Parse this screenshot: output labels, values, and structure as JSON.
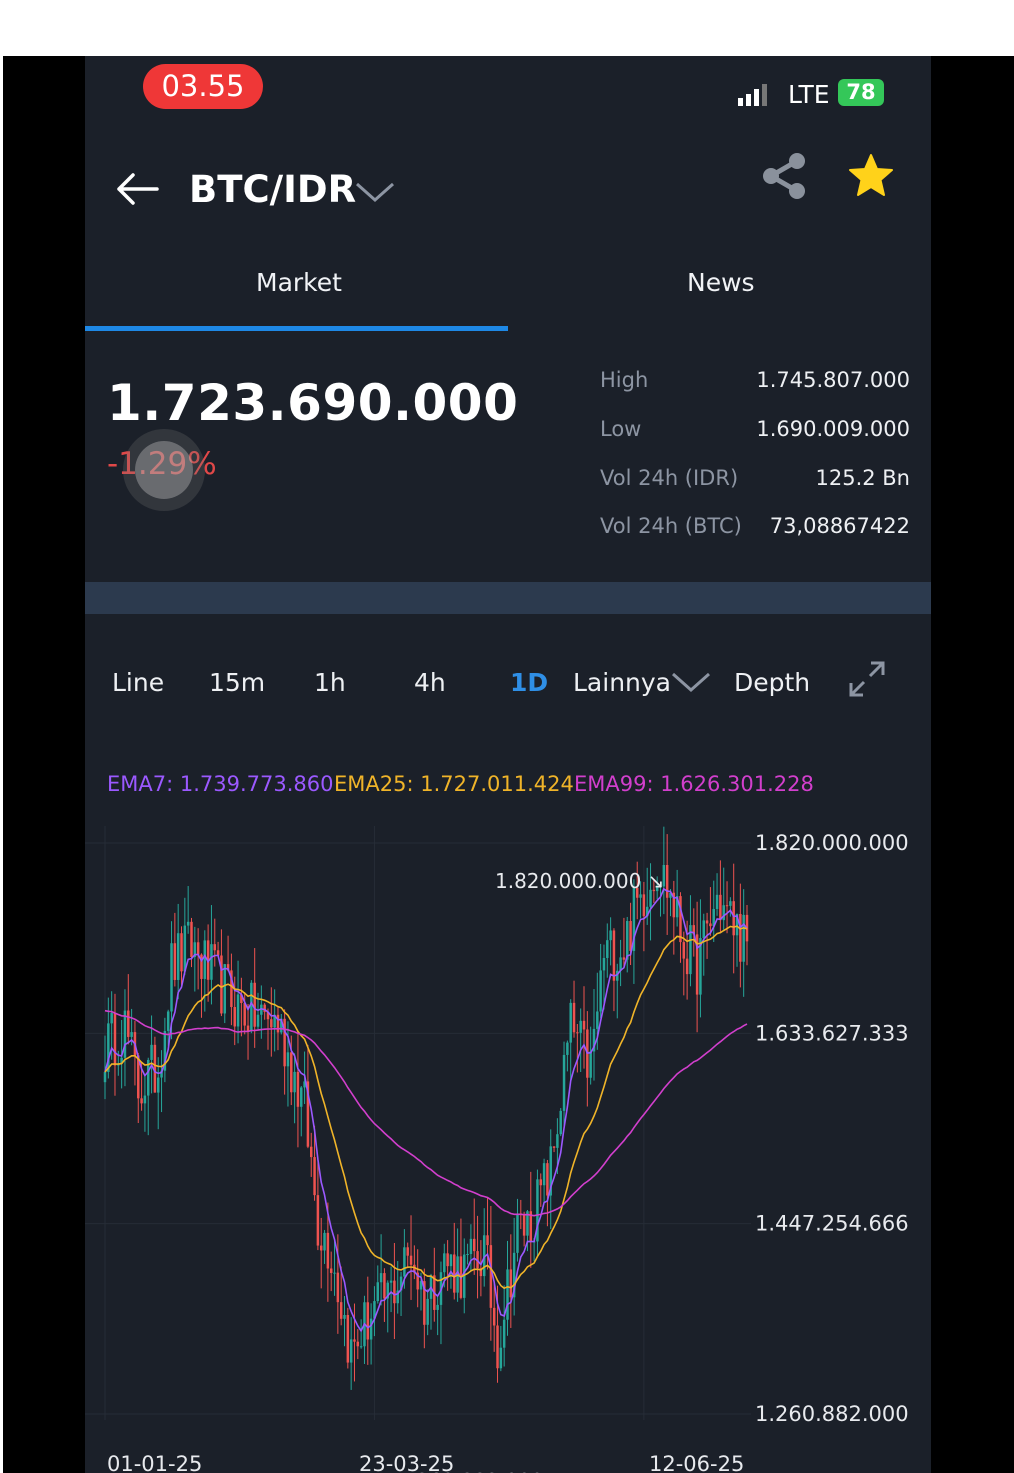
{
  "status_bar": {
    "time": "03.55",
    "network": "LTE",
    "battery": "78"
  },
  "header": {
    "pair": "BTC/IDR"
  },
  "tabs": [
    {
      "label": "Market"
    },
    {
      "label": "News"
    }
  ],
  "ticker": {
    "last_price": "1.723.690.000",
    "change_pct": "-1.29%",
    "stats": [
      {
        "label": "High",
        "value": "1.745.807.000"
      },
      {
        "label": "Low",
        "value": "1.690.009.000"
      },
      {
        "label": "Vol 24h (IDR)",
        "value": "125.2 Bn"
      },
      {
        "label": "Vol 24h (BTC)",
        "value": "73,08867422"
      }
    ]
  },
  "timeframes": [
    {
      "label": "Line"
    },
    {
      "label": "15m"
    },
    {
      "label": "1h"
    },
    {
      "label": "4h"
    },
    {
      "label": "1D"
    },
    {
      "label": "Lainnya"
    },
    {
      "label": "Depth"
    }
  ],
  "colors": {
    "bull": "#26a69a",
    "bear": "#ef5350",
    "ema7": "#9b59ff",
    "ema25": "#f0b429",
    "ema99": "#d23fcd",
    "accent": "#1e88e5"
  },
  "chart_data": {
    "type": "candlestick",
    "indicators": [
      {
        "name": "EMA7",
        "text": "EMA7: 1.739.773.860",
        "value": 1739773860
      },
      {
        "name": "EMA25",
        "text": "EMA25: 1.727.011.424",
        "value": 1727011424
      },
      {
        "name": "EMA99",
        "text": "EMA99: 1.626.301.228",
        "value": 1626301228
      }
    ],
    "y_ticks": [
      "1.820.000.000",
      "1.633.627.333",
      "1.447.254.666",
      "1.260.882.000"
    ],
    "y_tick_values": [
      1820000000,
      1633627333,
      1447254666,
      1260882000
    ],
    "ylim": [
      1260882000,
      1820000000
    ],
    "x_ticks": [
      "01-01-25",
      "23-03-25",
      "12-06-25"
    ],
    "x_tick_index": [
      0,
      81,
      162
    ],
    "annotations": {
      "max_label": "1.820.000.000",
      "max_value": 1820000000,
      "min_label": "1.260.882.000",
      "min_value": 1260882000
    },
    "trend_anchors_days": [
      0,
      6,
      10,
      16,
      20,
      26,
      30,
      40,
      46,
      52,
      60,
      64,
      68,
      74,
      80,
      86,
      92,
      96,
      102,
      108,
      114,
      118,
      124,
      128,
      134,
      140,
      146,
      150,
      156,
      160,
      166,
      170,
      174,
      178,
      184,
      188,
      193
    ],
    "trend_anchors_values": [
      1620000000,
      1640000000,
      1580000000,
      1600000000,
      1700000000,
      1720000000,
      1700000000,
      1660000000,
      1650000000,
      1645000000,
      1560000000,
      1450000000,
      1420000000,
      1320000000,
      1360000000,
      1380000000,
      1420000000,
      1370000000,
      1410000000,
      1400000000,
      1420000000,
      1330000000,
      1440000000,
      1450000000,
      1500000000,
      1640000000,
      1600000000,
      1710000000,
      1720000000,
      1760000000,
      1800000000,
      1770000000,
      1720000000,
      1700000000,
      1765000000,
      1745000000,
      1723690000
    ]
  }
}
